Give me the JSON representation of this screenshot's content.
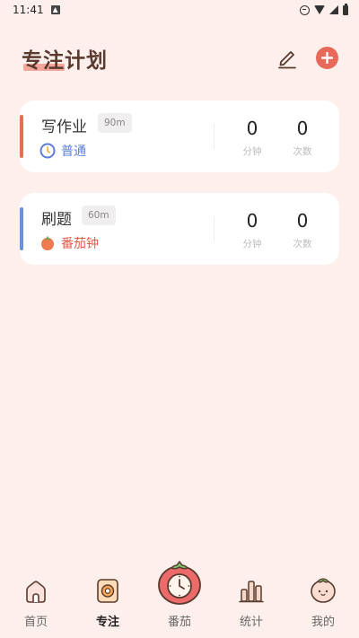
{
  "status_bar": {
    "time": "11:41"
  },
  "header": {
    "title": "专注计划"
  },
  "plans": [
    {
      "name": "写作业",
      "duration": "90m",
      "mode": "普通",
      "minutes": "0",
      "minutes_label": "分钟",
      "count": "0",
      "count_label": "次数",
      "accent_color": "#e1714f",
      "mode_color": "#5b7fd9"
    },
    {
      "name": "刷题",
      "duration": "60m",
      "mode": "番茄钟",
      "minutes": "0",
      "minutes_label": "分钟",
      "count": "0",
      "count_label": "次数",
      "accent_color": "#6b90d8",
      "mode_color": "#e55b4a"
    }
  ],
  "bottom_nav": {
    "items": [
      {
        "label": "首页",
        "icon": "house-icon"
      },
      {
        "label": "专注",
        "icon": "focus-icon"
      },
      {
        "label": "番茄",
        "icon": "tomato-clock-icon"
      },
      {
        "label": "统计",
        "icon": "bar-chart-icon"
      },
      {
        "label": "我的",
        "icon": "tomato-face-icon"
      }
    ],
    "active": "专注"
  },
  "colors": {
    "background": "#fdf0ec",
    "accent_red": "#e8695a",
    "title_brown": "#5a3a2e"
  }
}
